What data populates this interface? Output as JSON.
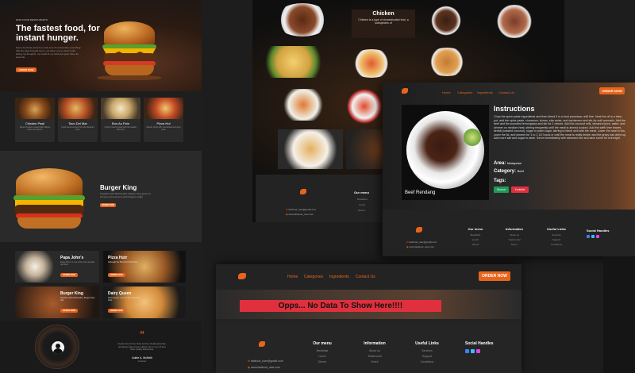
{
  "panelA": {
    "hero": {
      "tagline": "FAST FOOD RESTAURANTS",
      "title_line1": "The fastest food, for",
      "title_line2": "instant hunger.",
      "desc": "Some food has solved so early love it's looked like something that the dogs brought home, yet when you've tried it with letting my thoughts, my words & my food and grew there for seconds.",
      "button": "ORDER NOW"
    },
    "dishes": [
      {
        "name": "Chicken Pasil",
        "desc": "Sliced chicken cooked with Filipino herbs and spices."
      },
      {
        "name": "Taco Del Mar",
        "desc": "Fresh tacos served from the Mexican style."
      },
      {
        "name": "Bun Au Pain",
        "desc": "Crispy French bread with the healthy fast food."
      },
      {
        "name": "Pizza Hut",
        "desc": "Classic pizza with mozzarella and crisp crust."
      }
    ],
    "featured": {
      "title": "Burger King",
      "desc": "Together with McDonald's, Burger King grown to become synonymous with burgers today.",
      "button": "ORDER NOW"
    },
    "restaurants": [
      {
        "name": "Papa John's",
        "desc": "Papa John's is one of the most popular fast food.",
        "button": "ORDER NOW"
      },
      {
        "name": "Pizza Hutr",
        "desc": "Although the Pizza Hut Pizza Hutr.",
        "button": "ORDER NOW"
      },
      {
        "name": "Burger King",
        "desc": "Together with McDonald's, Burger King has.",
        "button": "ORDER NOW"
      },
      {
        "name": "Dairy Queen",
        "desc": "Dairy Queen is one of the oldest fast food.",
        "button": "ORDER NOW"
      }
    ],
    "testimonial": {
      "quote_mark": "”",
      "text": "People come for the whole services, Really appreciate. Excellence taste of every dishes, Aim to us on of best Taste, Quality Restaurants.",
      "name": "Adele A. McNeill",
      "role": "Customer"
    }
  },
  "panelB": {
    "overlay_title": "Chicken",
    "overlay_desc": "Chicken is a type of domesticated fowl, a subspecies of",
    "footer": {
      "menu_title": "Our menu",
      "menu_items": [
        "Breakfast",
        "Lunch",
        "Dinner"
      ],
      "email": "fastfood_user@gmail.com",
      "site": "www.fastfood_user.com"
    }
  },
  "panelC": {
    "nav": [
      "Home",
      "Categories",
      "Ingredients",
      "Contact Us"
    ],
    "order_button": "ORDER NOW",
    "instructions_title": "Instructions",
    "instructions_text": "Chop the spice paste ingredients and then blend it in a food processor until fine. Heat the oil in a stew pot, add the spice paste, cinnamon, cloves, star anise, and cardamom and stir-fry until aromatic. Add the beef and the pounded lemongrass and stir for 1 minute. Add the coconut milk, tamarind juice, water, and simmer on medium heat, stirring frequently until the meat is almost cooked. Add the kaffir lime leaves, kerisik (toasted coconut), sugar or palm sugar, stirring to blend well with the meat. Lower the heat to low, cover the lid, and simmer for 1 to 1 1/2 hours or until the meat is really tender and the gravy has dried up. Add more salt and sugar to taste. Serve immediately with steamed rice and save some for overnight.",
    "area_label": "Area:",
    "area_value": "Malaysian",
    "category_label": "Category:",
    "category_value": "Beef",
    "tags_label": "Tags:",
    "tag_source": "Source",
    "tag_youtube": "Youtube",
    "dish_caption": "Beef Rendang",
    "footer": {
      "email": "fastfood_user@gmail.com",
      "site": "www.fastfood_user.com",
      "cols": [
        {
          "title": "Our menu",
          "items": [
            "Breakfast",
            "Lunch",
            "Dinner"
          ]
        },
        {
          "title": "Information",
          "items": [
            "About us",
            "Testimonial",
            "Event"
          ]
        },
        {
          "title": "Useful Links",
          "items": [
            "Services",
            "Support",
            "Conditions"
          ]
        },
        {
          "title": "Social Handles",
          "items": []
        }
      ]
    }
  },
  "panelD": {
    "nav": [
      "Home",
      "Categories",
      "Ingredients",
      "Contact Us"
    ],
    "order_button": "ORDER NOW",
    "no_data": "Opps... No Data To Show Here!!!!",
    "footer": {
      "email": "fastfood_user@gmail.com",
      "site": "www.fastfood_user.com",
      "cols": [
        {
          "title": "Our menu",
          "items": [
            "Breakfast",
            "Lunch",
            "Dinner"
          ]
        },
        {
          "title": "Information",
          "items": [
            "About us",
            "Testimonial",
            "Event"
          ]
        },
        {
          "title": "Useful Links",
          "items": [
            "Services",
            "Support",
            "Conditions"
          ]
        },
        {
          "title": "Social Handles",
          "items": []
        }
      ]
    }
  },
  "colors": {
    "accent": "#e8641b",
    "banner": "#e0303e",
    "tag_green": "#1f9a5b",
    "tag_red": "#e0303e"
  },
  "icons": [
    "logo-icon",
    "quote-icon",
    "facebook-icon",
    "twitter-icon",
    "instagram-icon",
    "email-icon",
    "globe-icon"
  ]
}
